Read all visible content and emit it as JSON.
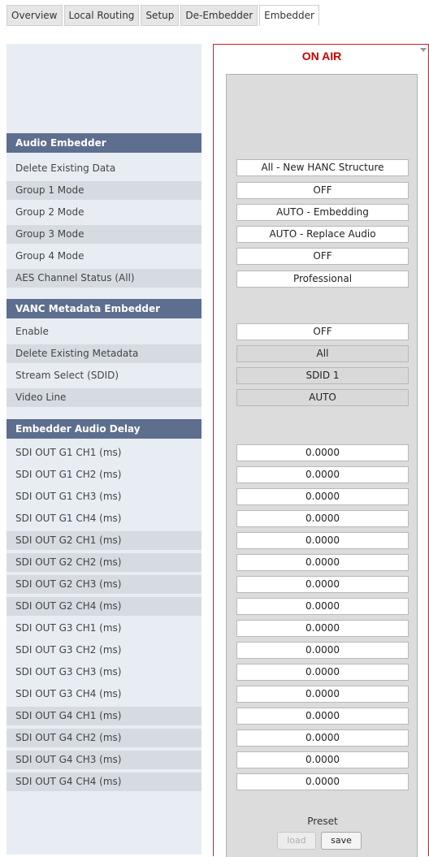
{
  "tabs": [
    {
      "label": "Overview"
    },
    {
      "label": "Local Routing"
    },
    {
      "label": "Setup"
    },
    {
      "label": "De-Embedder"
    },
    {
      "label": "Embedder"
    }
  ],
  "active_tab": "Embedder",
  "panel": {
    "status": "ON AIR",
    "status_color": "#cc0000",
    "preset_label": "Preset",
    "load_label": "load",
    "save_label": "save"
  },
  "sections": {
    "audio_embedder": {
      "title": "Audio Embedder",
      "rows": [
        {
          "label": "Delete Existing Data",
          "value": "All - New HANC Structure"
        },
        {
          "label": "Group 1 Mode",
          "value": "OFF"
        },
        {
          "label": "Group 2 Mode",
          "value": "AUTO - Embedding"
        },
        {
          "label": "Group 3 Mode",
          "value": "AUTO - Replace Audio"
        },
        {
          "label": "Group 4 Mode",
          "value": "OFF"
        },
        {
          "label": "AES Channel Status (All)",
          "value": "Professional"
        }
      ]
    },
    "vanc": {
      "title": "VANC Metadata Embedder",
      "rows": [
        {
          "label": "Enable",
          "value": "OFF"
        },
        {
          "label": "Delete Existing Metadata",
          "value": "All"
        },
        {
          "label": "Stream Select (SDID)",
          "value": "SDID 1"
        },
        {
          "label": "Video Line",
          "value": "AUTO"
        }
      ]
    },
    "delay": {
      "title": "Embedder Audio Delay",
      "rows": [
        {
          "label": "SDI OUT G1 CH1 (ms)",
          "value": "0.0000"
        },
        {
          "label": "SDI OUT G1 CH2 (ms)",
          "value": "0.0000"
        },
        {
          "label": "SDI OUT G1 CH3 (ms)",
          "value": "0.0000"
        },
        {
          "label": "SDI OUT G1 CH4 (ms)",
          "value": "0.0000"
        },
        {
          "label": "SDI OUT G2 CH1 (ms)",
          "value": "0.0000"
        },
        {
          "label": "SDI OUT G2 CH2 (ms)",
          "value": "0.0000"
        },
        {
          "label": "SDI OUT G2 CH3 (ms)",
          "value": "0.0000"
        },
        {
          "label": "SDI OUT G2 CH4 (ms)",
          "value": "0.0000"
        },
        {
          "label": "SDI OUT G3 CH1 (ms)",
          "value": "0.0000"
        },
        {
          "label": "SDI OUT G3 CH2 (ms)",
          "value": "0.0000"
        },
        {
          "label": "SDI OUT G3 CH3 (ms)",
          "value": "0.0000"
        },
        {
          "label": "SDI OUT G3 CH4 (ms)",
          "value": "0.0000"
        },
        {
          "label": "SDI OUT G4 CH1 (ms)",
          "value": "0.0000"
        },
        {
          "label": "SDI OUT G4 CH2 (ms)",
          "value": "0.0000"
        },
        {
          "label": "SDI OUT G4 CH3 (ms)",
          "value": "0.0000"
        },
        {
          "label": "SDI OUT G4 CH4 (ms)",
          "value": "0.0000"
        }
      ]
    }
  }
}
